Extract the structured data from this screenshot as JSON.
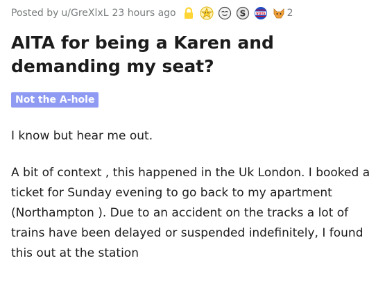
{
  "meta": {
    "posted_prefix": "Posted by",
    "username": "u/GreXlxL",
    "time": "23 hours ago",
    "award_count": "2",
    "icons": [
      "lock-icon",
      "helpful-award-icon",
      "wholesome-award-icon",
      "silver-award-icon",
      "vote-award-icon",
      "cat-award-icon"
    ],
    "colors": {
      "lock": "#ffd635",
      "meta_text": "#787c7e"
    }
  },
  "post": {
    "title": "AITA for being a Karen and demanding my seat?",
    "flair": "Not the A-hole",
    "flair_color": "#8f9bf3",
    "paragraphs": [
      "I know but hear me out.",
      "A bit of context , this happened in the Uk London. I booked a ticket for Sunday evening to go back to my apartment (Northampton ). Due to an accident on the tracks a lot of trains have been delayed or suspended indefinitely, I found this out at the station"
    ]
  }
}
